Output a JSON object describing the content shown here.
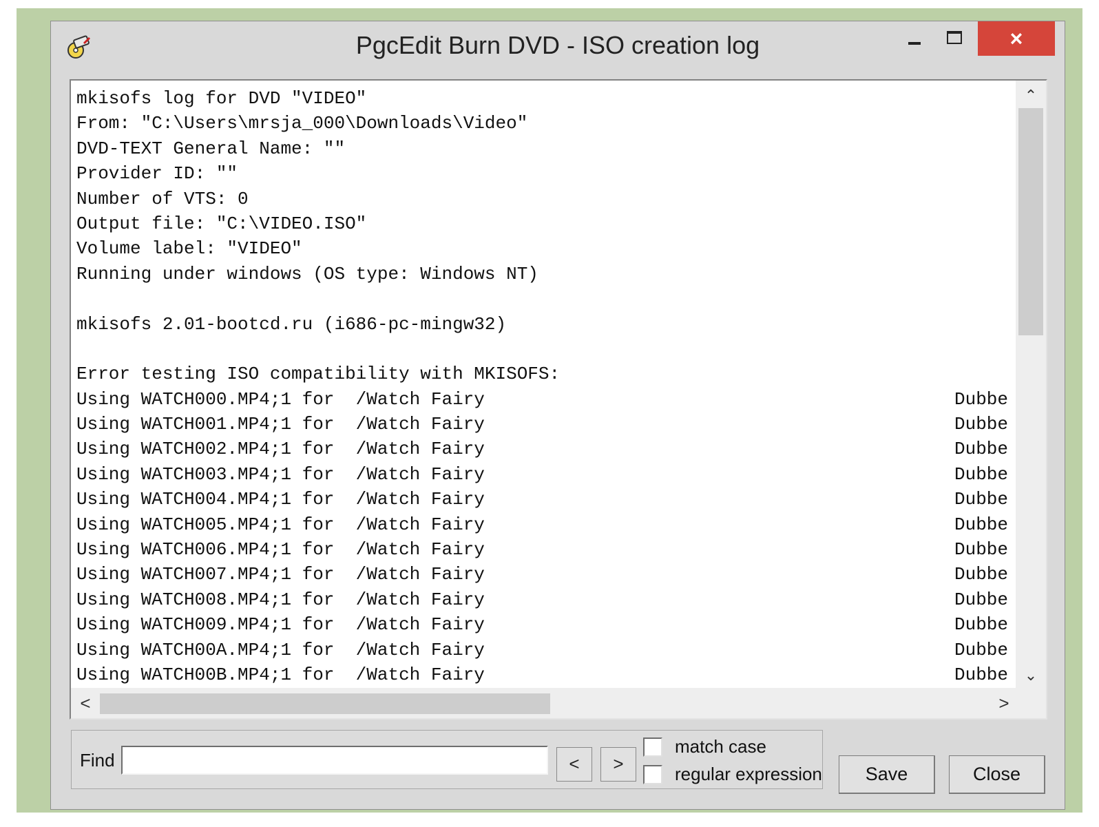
{
  "window": {
    "title": "PgcEdit Burn DVD - ISO creation log",
    "icon": "dvd-burn-icon",
    "minimize_label": "minimize",
    "maximize_label": "maximize",
    "close_label": "×"
  },
  "log": {
    "lines": [
      "mkisofs log for DVD \"VIDEO\"",
      "From: \"C:\\Users\\mrsja_000\\Downloads\\Video\"",
      "DVD-TEXT General Name: \"\"",
      "Provider ID: \"\"",
      "Number of VTS: 0",
      "Output file: \"C:\\VIDEO.ISO\"",
      "Volume label: \"VIDEO\"",
      "Running under windows (OS type: Windows NT)",
      "",
      "mkisofs 2.01-bootcd.ru (i686-pc-mingw32)",
      "",
      "Error testing ISO compatibility with MKISOFS:",
      "Using WATCH000.MP4;1 for  /Watch Fairy",
      "Using WATCH001.MP4;1 for  /Watch Fairy",
      "Using WATCH002.MP4;1 for  /Watch Fairy",
      "Using WATCH003.MP4;1 for  /Watch Fairy",
      "Using WATCH004.MP4;1 for  /Watch Fairy",
      "Using WATCH005.MP4;1 for  /Watch Fairy",
      "Using WATCH006.MP4;1 for  /Watch Fairy",
      "Using WATCH007.MP4;1 for  /Watch Fairy",
      "Using WATCH008.MP4;1 for  /Watch Fairy",
      "Using WATCH009.MP4;1 for  /Watch Fairy",
      "Using WATCH00A.MP4;1 for  /Watch Fairy",
      "Using WATCH00B.MP4;1 for  /Watch Fairy"
    ],
    "right_column": {
      "12": "Dubbe",
      "13": "Dubbe",
      "14": "Dubbe",
      "15": "Dubbe",
      "16": "Dubbe",
      "17": "Dubbe",
      "18": "Dubbe",
      "19": "Dubbe",
      "20": "Dubbe",
      "21": "Dubbe",
      "22": "Dubbe",
      "23": "Dubbe"
    }
  },
  "scrollbars": {
    "up": "^",
    "down": "v",
    "left": "<",
    "right": ">"
  },
  "find": {
    "label": "Find",
    "value": "",
    "prev_label": "<",
    "next_label": ">",
    "match_case_label": "match case",
    "match_case_checked": false,
    "regex_label": "regular expression",
    "regex_checked": false
  },
  "buttons": {
    "save": "Save",
    "close": "Close"
  }
}
